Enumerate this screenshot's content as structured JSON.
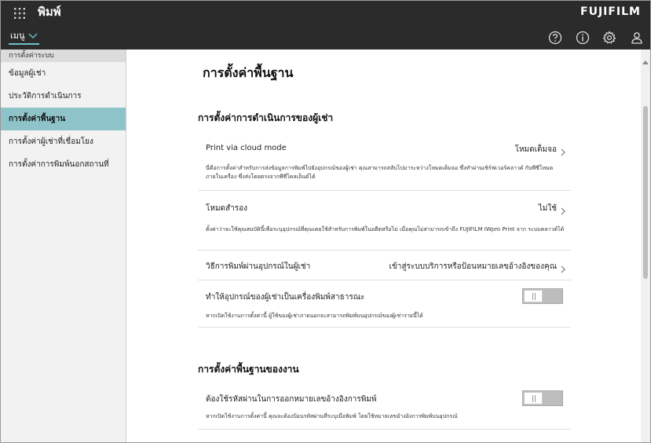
{
  "header": {
    "app_title": "พิมพ์",
    "brand": "FUJIFILM",
    "menu_label": "เมนู",
    "icons": [
      "grid-icon",
      "help-icon",
      "info-icon",
      "gear-icon",
      "user-icon"
    ]
  },
  "sidebar": {
    "section_label": "การตั้งค่าระบบ",
    "items": [
      {
        "label": "ข้อมูลผู้เช่า",
        "active": false
      },
      {
        "label": "ประวัติการดำเนินการ",
        "active": false
      },
      {
        "label": "การตั้งค่าพื้นฐาน",
        "active": true
      },
      {
        "label": "การตั้งค่าผู้เช่าที่เชื่อมโยง",
        "active": false
      },
      {
        "label": "การตั้งค่าการพิมพ์นอกสถานที่",
        "active": false
      }
    ]
  },
  "main": {
    "page_title": "การตั้งค่าพื้นฐาน",
    "section1": {
      "title": "การตั้งค่าการดำเนินการของผู้เช่า",
      "rows": [
        {
          "label": "Print via cloud mode",
          "value": "โหมดเต็มจอ",
          "desc": "นี่คือการตั้งค่าสำหรับการส่งข้อมูลการพิมพ์ไปยังอุปกรณ์ของผู้เช่า คุณสามารถสลับไปมาระหว่างโหมดเต็มจอ ซึ่งทำผ่านเซิร์ฟเวอร์คลาวด์ กับพีซีโหมดภายในเครื่อง ซึ่งส่งโดยตรงจากพีซีไคลเอ็นต์ได้"
        },
        {
          "label": "โหมดสำรอง",
          "value": "ไม่ใช้",
          "desc": "ตั้งค่าว่าจะใช้คุณสมบัตินี้เพื่อระบุอุปกรณ์ที่คุณเคยใช้สำหรับการพิมพ์ในอดีตหรือไม่ เมื่อคุณไม่สามารถเข้าถึง FUJIFILM IWpro Print จาก ระบบคลาวด์ได้"
        },
        {
          "label": "วิธีการพิมพ์ผ่านอุปกรณ์ในผู้เช่า",
          "value": "เข้าสู่ระบบบริการหรือป้อนหมายเลขอ้างอิงของคุณ",
          "desc": ""
        },
        {
          "label": "ทำให้อุปกรณ์ของผู้เช่าเป็นเครื่องพิมพ์สาธารณะ",
          "value": "",
          "toggle": false,
          "desc": "หากเปิดใช้งานการตั้งค่านี้ ผู้ใช้ของผู้เช่าภายนอกจะสามารถพิมพ์บนอุปกรณ์ของผู้เช่ารายนี้ได้"
        }
      ]
    },
    "section2": {
      "title": "การตั้งค่าพื้นฐานของงาน",
      "rows": [
        {
          "label": "ต้องใช้รหัสผ่านในการออกหมายเลขอ้างอิงการพิมพ์",
          "toggle": false,
          "desc": "หากเปิดใช้งานการตั้งค่านี้ คุณจะต้องป้อนรหัสผ่านที่ระบุเมื่อพิมพ์ โดยใช้หมายเลขอ้างอิงการพิมพ์บนอุปกรณ์"
        }
      ]
    }
  },
  "colors": {
    "header_bg": "#2b2b2b",
    "accent": "#6cc0c9",
    "sidebar_active": "#8ec4c9",
    "toggle_off": "#bdbdbd"
  }
}
